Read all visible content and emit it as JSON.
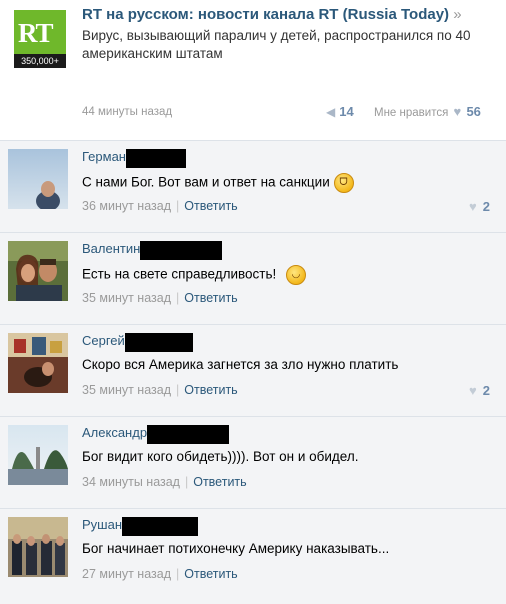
{
  "post": {
    "logo_letters": "RT",
    "logo_subscribers": "350,000+",
    "title": "RT на русском: новости канала RT (Russia Today)",
    "title_arrow": "»",
    "text": "Вирус, вызывающий паралич у детей, распространился по 40 американским штатам",
    "time": "44 минуты назад",
    "shares": "14",
    "like_label": "Мне нравится",
    "likes": "56"
  },
  "comments": [
    {
      "name": "Герман",
      "text": "С нами Бог. Вот вам и ответ на санкции",
      "emoji": "laugh",
      "time": "36 минут назад",
      "reply": "Ответить",
      "likes": "2"
    },
    {
      "name": "Валентин",
      "text": "Есть на свете справедливость!",
      "emoji": "smile",
      "time": "35 минут назад",
      "reply": "Ответить",
      "likes": ""
    },
    {
      "name": "Сергей",
      "text": "Скоро вся Америка загнется за зло нужно платить",
      "emoji": "",
      "time": "35 минут назад",
      "reply": "Ответить",
      "likes": "2"
    },
    {
      "name": "Александр",
      "text": "Бог видит кого обидеть)))). Вот он и обидел.",
      "emoji": "",
      "time": "34 минуты назад",
      "reply": "Ответить",
      "likes": ""
    },
    {
      "name": "Рушан",
      "text": "Бог начинает потихонечку Америку наказывать...",
      "emoji": "",
      "time": "27 минут назад",
      "reply": "Ответить",
      "likes": ""
    }
  ],
  "colors": {
    "link": "#2b587a",
    "meta": "#9a9a9a",
    "rt_green": "#6fb82b",
    "redaction": "#000000"
  }
}
